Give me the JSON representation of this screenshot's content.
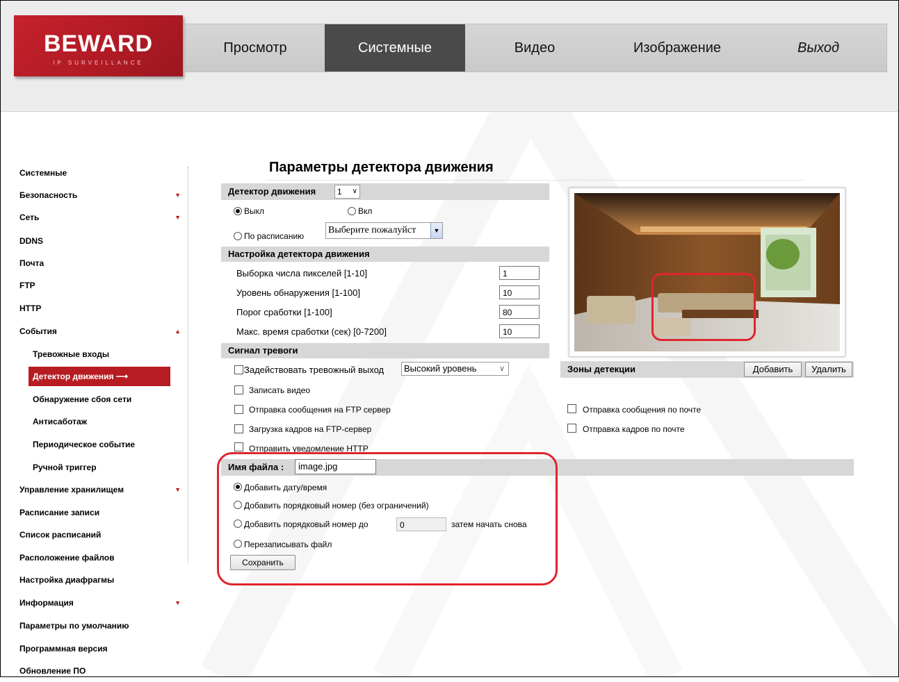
{
  "logo": {
    "main": "BEWARD",
    "sub": "IP SURVEILLANCE"
  },
  "nav": [
    "Просмотр",
    "Системные",
    "Видео",
    "Изображение",
    "Выход"
  ],
  "sidebar": {
    "items": [
      {
        "label": "Системные"
      },
      {
        "label": "Безопасность"
      },
      {
        "label": "Сеть"
      },
      {
        "label": "DDNS"
      },
      {
        "label": "Почта"
      },
      {
        "label": "FTP"
      },
      {
        "label": "HTTP"
      },
      {
        "label": "События"
      },
      {
        "label": "Тревожные входы"
      },
      {
        "label": "Детектор движения"
      },
      {
        "label": "Обнаружение сбоя сети"
      },
      {
        "label": "Антисаботаж"
      },
      {
        "label": "Периодическое событие"
      },
      {
        "label": "Ручной триггер"
      },
      {
        "label": "Управление хранилищем"
      },
      {
        "label": "Расписание записи"
      },
      {
        "label": "Список расписаний"
      },
      {
        "label": "Расположение файлов"
      },
      {
        "label": "Настройка диафрагмы"
      },
      {
        "label": "Информация"
      },
      {
        "label": "Параметры по умолчанию"
      },
      {
        "label": "Программная версия"
      },
      {
        "label": "Обновление ПО"
      }
    ],
    "expand_arrow": "▼",
    "collapse_arrow": "▲",
    "active_arrow": "⟶"
  },
  "page_title": "Параметры детектора движения",
  "detector": {
    "label": "Детектор движения",
    "select_value": "1",
    "off_label": "Выкл",
    "on_label": "Вкл",
    "schedule_label": "По расписанию",
    "schedule_placeholder": "Выберите пожалуйст"
  },
  "settings": {
    "header": "Настройка детектора движения",
    "rows": [
      {
        "label": "Выборка числа пикселей [1-10]",
        "value": "1"
      },
      {
        "label": "Уровень обнаружения [1-100]",
        "value": "10"
      },
      {
        "label": "Порог сработки [1-100]",
        "value": "80"
      },
      {
        "label": "Макс. время сработки (сек) [0-7200]",
        "value": "10"
      }
    ]
  },
  "alarm": {
    "header": "Сигнал тревоги",
    "output_label": "Задействовать тревожный выход",
    "output_level": "Высокий уровень",
    "record_video": "Записать видео",
    "ftp_message": "Отправка сообщения на FTP сервер",
    "ftp_upload": "Загрузка кадров на FTP-сервер",
    "http_notify": "Отправить уведомление HTTP",
    "mail_message": "Отправка сообщения по почте",
    "mail_frames": "Отправка кадров по почте"
  },
  "zones": {
    "label": "Зоны детекции",
    "add_button": "Добавить",
    "delete_button": "Удалить"
  },
  "filename": {
    "label": "Имя файла :",
    "value": "image.jpg",
    "opt_datetime": "Добавить дату/время",
    "opt_seq_unlimited": "Добавить порядковый номер (без ограничений)",
    "opt_seq_until": "Добавить порядковый номер до",
    "seq_until_value": "0",
    "opt_seq_restart": "затем начать снова",
    "opt_overwrite": "Перезаписывать файл",
    "save_button": "Сохранить"
  },
  "colors": {
    "accent_red": "#b71c23",
    "highlight_red": "#e0242d",
    "bar_gray": "#d7d7d7",
    "nav_active": "#4a4a4a"
  }
}
